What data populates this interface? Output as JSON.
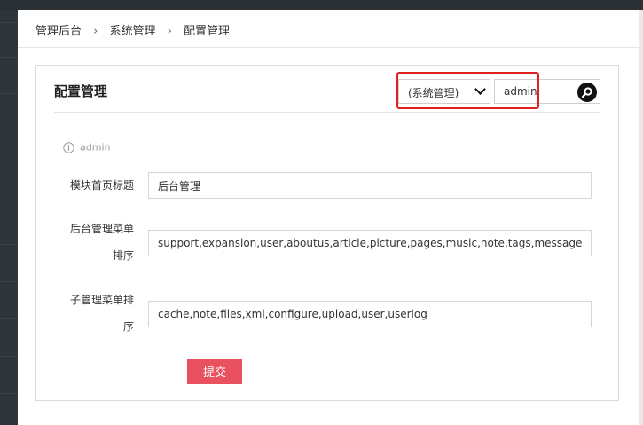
{
  "breadcrumb": [
    "管理后台",
    "系统管理",
    "配置管理"
  ],
  "breadcrumb_separator": "›",
  "panel": {
    "title": "配置管理",
    "search": {
      "select_value": "(系统管理)",
      "input_value": "admin",
      "button_icon": "search-icon"
    }
  },
  "info": {
    "icon": "info-icon",
    "text": "admin"
  },
  "form": {
    "fields": [
      {
        "label": "模块首页标题",
        "value": "后台管理"
      },
      {
        "label_line1": "后台管理菜单",
        "label_line2": "排序",
        "value": "support,expansion,user,aboutus,article,picture,pages,music,note,tags,message,check"
      },
      {
        "label_line1": "子管理菜单排",
        "label_line2": "序",
        "value": "cache,note,files,xml,configure,upload,user,userlog"
      }
    ],
    "submit_label": "提交"
  },
  "colors": {
    "accent": "#e8515d",
    "highlight": "#e01f1f",
    "sidebar": "#2f343a"
  }
}
